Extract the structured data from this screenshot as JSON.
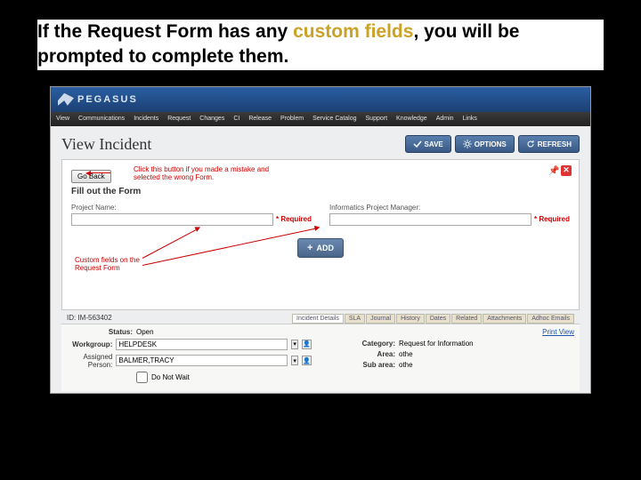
{
  "caption": {
    "part1": "If the Request Form has any ",
    "highlight": "custom fields",
    "part2": ", you will be prompted to complete them."
  },
  "app": {
    "logo": "PEGASUS",
    "menu": [
      "View",
      "Communications",
      "Incidents",
      "Request",
      "Changes",
      "CI",
      "Release",
      "Problem",
      "Service Catalog",
      "Support",
      "Knowledge",
      "Admin",
      "Links"
    ],
    "page_title": "View Incident",
    "buttons": {
      "save": "SAVE",
      "options": "OPTIONS",
      "refresh": "REFRESH"
    }
  },
  "panel": {
    "go_back": "Go Back",
    "section_title": "Fill out the Form",
    "fields": {
      "project_name": {
        "label": "Project Name:",
        "required": "* Required"
      },
      "ipm": {
        "label": "Informatics Project Manager:",
        "required": "* Required"
      }
    },
    "add": "ADD",
    "annotations": {
      "goback_note": "Click this button if you made a mistake and selected the wrong Form.",
      "custom_note": "Custom fields on the Request Form"
    }
  },
  "footer": {
    "id": "ID: IM-563402",
    "tabs": [
      "Incident Details",
      "SLA",
      "Journal",
      "History",
      "Dates",
      "Related",
      "Attachments",
      "Adhoc Emails"
    ],
    "print": "Print View",
    "left": {
      "status_label": "Status:",
      "status_value": "Open",
      "workgroup_label": "Workgroup:",
      "workgroup_value": "HELPDESK",
      "assigned_label": "Assigned Person:",
      "assigned_value": "BALMER,TRACY",
      "dnw_label": "Do Not Wait"
    },
    "right": {
      "category_label": "Category:",
      "category_value": "Request for Information",
      "area_label": "Area:",
      "area_value": "othe",
      "subarea_label": "Sub area:",
      "subarea_value": "othe"
    }
  }
}
